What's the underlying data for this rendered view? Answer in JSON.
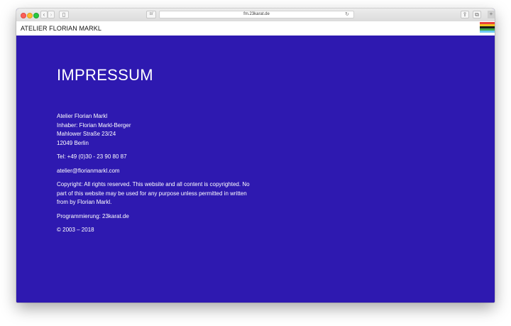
{
  "browser": {
    "url": "fm.23karat.de",
    "reader_glyph": "≡/"
  },
  "header": {
    "brand": "ATELIER FLORIAN MARKL",
    "stripes": [
      "#e8403d",
      "#f0c21d",
      "#1a1a1a",
      "#3fa64a",
      "#6fc9f2"
    ]
  },
  "page": {
    "title": "IMPRESSUM",
    "address_lines": [
      "Atelier Florian Markl",
      "Inhaber: Florian Markl-Berger",
      "Mahlower Straße 23/24",
      "12049 Berlin"
    ],
    "phone": "Tel: +49 (0)30 - 23 90 80 87",
    "email": "atelier@florianmarkl.com",
    "copyright_lines": [
      "Copyright: All rights reserved. This website and all content is copyrighted. No",
      "part of this website may be used for any purpose unless permitted in written",
      "from by Florian Markl."
    ],
    "programming": "Programmierung: 23karat.de",
    "years": "© 2003 – 2018"
  }
}
